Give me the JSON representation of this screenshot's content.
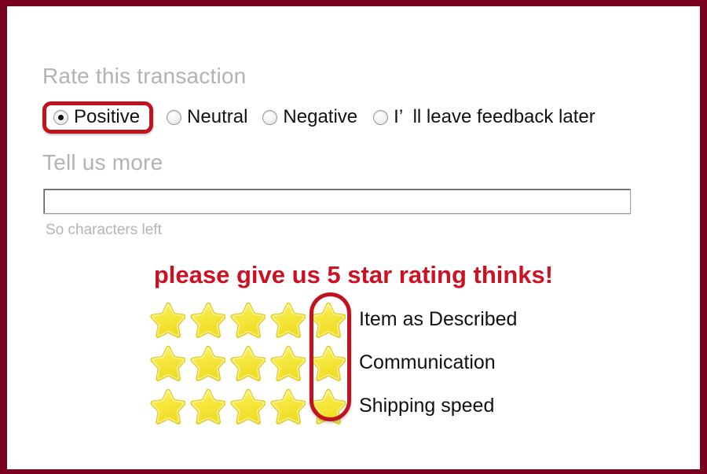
{
  "frame": {
    "border_color": "#7a0020"
  },
  "rate_section": {
    "heading": "Rate this transaction",
    "options": [
      {
        "label": "Positive",
        "checked": true,
        "highlighted": true
      },
      {
        "label": "Neutral",
        "checked": false,
        "highlighted": false
      },
      {
        "label": "Negative",
        "checked": false,
        "highlighted": false
      },
      {
        "label": "I’  ll leave feedback later",
        "checked": false,
        "highlighted": false
      }
    ]
  },
  "tell_section": {
    "heading": "Tell us more",
    "input_value": "",
    "input_placeholder": "",
    "characters_left": "So characters left"
  },
  "callout": {
    "text": "please give us 5 star rating thinks!",
    "color": "#cc1122"
  },
  "ratings": {
    "star_icon": "star-icon",
    "max_stars": 5,
    "highlighted_star_index": 5,
    "highlight_color": "#c1121f",
    "rows": [
      {
        "label": "Item as Described",
        "value": 5
      },
      {
        "label": "Communication",
        "value": 5
      },
      {
        "label": "Shipping speed",
        "value": 5
      }
    ]
  }
}
